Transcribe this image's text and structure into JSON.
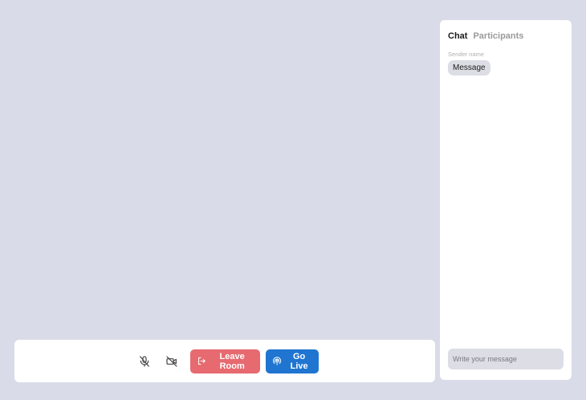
{
  "controls": {
    "mic_icon": "mic-off-icon",
    "camera_icon": "video-off-icon",
    "leave_label": "Leave Room",
    "live_label": "Go Live",
    "leave_color": "#e66a6f",
    "live_color": "#1f75d0"
  },
  "chat": {
    "tabs": [
      {
        "label": "Chat",
        "active": true
      },
      {
        "label": "Participants",
        "active": false
      }
    ],
    "messages": [
      {
        "sender": "Sender name",
        "text": "Message"
      }
    ],
    "input_placeholder": "Write your message"
  },
  "colors": {
    "background": "#d9dbe8",
    "panel": "#ffffff",
    "bubble": "#dcdde5"
  }
}
